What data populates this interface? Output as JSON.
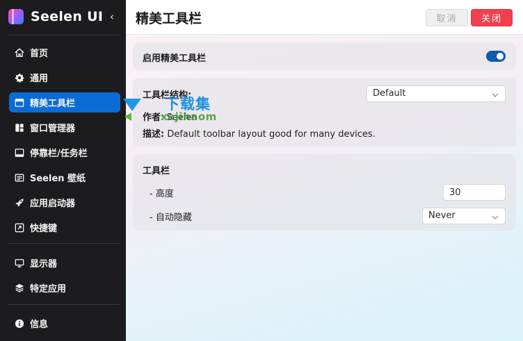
{
  "app": {
    "title": "Seelen UI",
    "collapse_glyph": "‹"
  },
  "sidebar": {
    "items": [
      {
        "label": "首页",
        "icon": "home-icon"
      },
      {
        "label": "通用",
        "icon": "gear-icon"
      },
      {
        "label": "精美工具栏",
        "icon": "toolbar-icon",
        "active": true
      },
      {
        "label": "窗口管理器",
        "icon": "window-manager-icon"
      },
      {
        "label": "停靠栏/任务栏",
        "icon": "dock-icon"
      },
      {
        "label": "Seelen 壁纸",
        "icon": "wallpaper-icon"
      },
      {
        "label": "应用启动器",
        "icon": "rocket-icon"
      },
      {
        "label": "快捷键",
        "icon": "shortcut-icon"
      },
      {
        "label": "显示器",
        "icon": "monitor-icon"
      },
      {
        "label": "特定应用",
        "icon": "layers-icon"
      },
      {
        "label": "信息",
        "icon": "info-icon"
      }
    ]
  },
  "header": {
    "title": "精美工具栏",
    "cancel_label": "取消",
    "close_label": "关闭"
  },
  "enable_card": {
    "label": "启用精美工具栏",
    "enabled": true
  },
  "structure_card": {
    "label": "工具栏结构:",
    "selected": "Default",
    "author_label": "作者",
    "author_value": "Seelen",
    "description_label": "描述:",
    "description_value": "Default toolbar layout good for many devices."
  },
  "toolbar_card": {
    "title": "工具栏",
    "height_label": "- 高度",
    "height_value": "30",
    "autohide_label": "- 自动隐藏",
    "autohide_value": "Never"
  },
  "watermark": {
    "text": "下载集",
    "sub": "xajihaom"
  },
  "colors": {
    "accent": "#0a6cd6",
    "danger": "#f2414e",
    "toggle_on": "#0b5cad",
    "sidebar_bg": "#1c1c1e"
  }
}
